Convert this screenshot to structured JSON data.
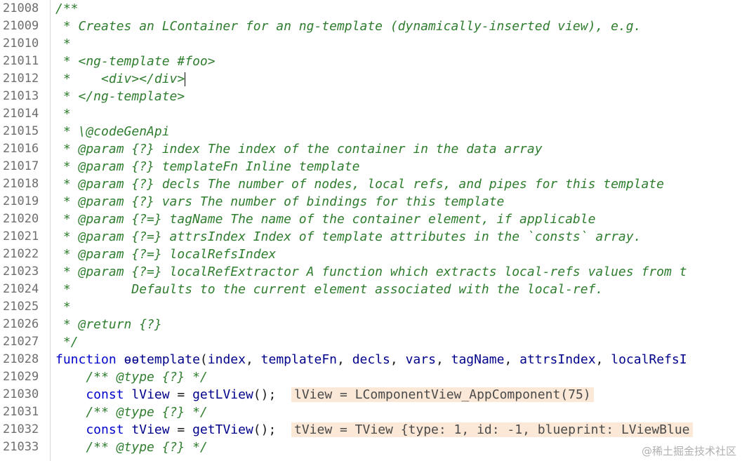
{
  "lines": [
    {
      "n": "21008",
      "parts": [
        {
          "c": "cm",
          "t": "/**"
        }
      ]
    },
    {
      "n": "21009",
      "parts": [
        {
          "c": "cm",
          "t": " * Creates an LContainer for an ng-template (dynamically-inserted view), e.g."
        }
      ]
    },
    {
      "n": "21010",
      "parts": [
        {
          "c": "cm",
          "t": " *"
        }
      ]
    },
    {
      "n": "21011",
      "parts": [
        {
          "c": "cm",
          "t": " * <ng-template #foo>"
        }
      ]
    },
    {
      "n": "21012",
      "parts": [
        {
          "c": "cm",
          "t": " *    <div></div>"
        },
        {
          "c": "caret",
          "t": ""
        }
      ]
    },
    {
      "n": "21013",
      "parts": [
        {
          "c": "cm",
          "t": " * </ng-template>"
        }
      ]
    },
    {
      "n": "21014",
      "parts": [
        {
          "c": "cm",
          "t": " *"
        }
      ]
    },
    {
      "n": "21015",
      "parts": [
        {
          "c": "cm",
          "t": " * \\@codeGenApi"
        }
      ]
    },
    {
      "n": "21016",
      "parts": [
        {
          "c": "cm",
          "t": " * @param {?} index The index of the container in the data array"
        }
      ]
    },
    {
      "n": "21017",
      "parts": [
        {
          "c": "cm",
          "t": " * @param {?} templateFn Inline template"
        }
      ]
    },
    {
      "n": "21018",
      "parts": [
        {
          "c": "cm",
          "t": " * @param {?} decls The number of nodes, local refs, and pipes for this template"
        }
      ]
    },
    {
      "n": "21019",
      "parts": [
        {
          "c": "cm",
          "t": " * @param {?} vars The number of bindings for this template"
        }
      ]
    },
    {
      "n": "21020",
      "parts": [
        {
          "c": "cm",
          "t": " * @param {?=} tagName The name of the container element, if applicable"
        }
      ]
    },
    {
      "n": "21021",
      "parts": [
        {
          "c": "cm",
          "t": " * @param {?=} attrsIndex Index of template attributes in the `consts` array."
        }
      ]
    },
    {
      "n": "21022",
      "parts": [
        {
          "c": "cm",
          "t": " * @param {?=} localRefsIndex"
        }
      ]
    },
    {
      "n": "21023",
      "parts": [
        {
          "c": "cm",
          "t": " * @param {?=} localRefExtractor A function which extracts local-refs values from t"
        }
      ]
    },
    {
      "n": "21024",
      "parts": [
        {
          "c": "cm",
          "t": " *        Defaults to the current element associated with the local-ref."
        }
      ]
    },
    {
      "n": "21025",
      "parts": [
        {
          "c": "cm",
          "t": " *"
        }
      ]
    },
    {
      "n": "21026",
      "parts": [
        {
          "c": "cm",
          "t": " * @return {?}"
        }
      ]
    },
    {
      "n": "21027",
      "parts": [
        {
          "c": "cm",
          "t": " */"
        }
      ]
    },
    {
      "n": "21028",
      "parts": [
        {
          "c": "kw",
          "t": "function"
        },
        {
          "c": "tx",
          "t": " "
        },
        {
          "c": "fn",
          "t": "ɵɵtemplate"
        },
        {
          "c": "tx",
          "t": "("
        },
        {
          "c": "fn",
          "t": "index"
        },
        {
          "c": "tx",
          "t": ", "
        },
        {
          "c": "fn",
          "t": "templateFn"
        },
        {
          "c": "tx",
          "t": ", "
        },
        {
          "c": "fn",
          "t": "decls"
        },
        {
          "c": "tx",
          "t": ", "
        },
        {
          "c": "fn",
          "t": "vars"
        },
        {
          "c": "tx",
          "t": ", "
        },
        {
          "c": "fn",
          "t": "tagName"
        },
        {
          "c": "tx",
          "t": ", "
        },
        {
          "c": "fn",
          "t": "attrsIndex"
        },
        {
          "c": "tx",
          "t": ", "
        },
        {
          "c": "fn",
          "t": "localRefsI"
        }
      ]
    },
    {
      "n": "21029",
      "parts": [
        {
          "c": "cm",
          "t": "    /** @type {?} */"
        }
      ]
    },
    {
      "n": "21030",
      "parts": [
        {
          "c": "kw",
          "t": "    const"
        },
        {
          "c": "tx",
          "t": " "
        },
        {
          "c": "fn",
          "t": "lView"
        },
        {
          "c": "tx",
          "t": " = "
        },
        {
          "c": "fn",
          "t": "getLView"
        },
        {
          "c": "tx",
          "t": "();  "
        },
        {
          "c": "hint",
          "t": "lView = LComponentView_AppComponent(75)"
        }
      ]
    },
    {
      "n": "21031",
      "parts": [
        {
          "c": "cm",
          "t": "    /** @type {?} */"
        }
      ]
    },
    {
      "n": "21032",
      "parts": [
        {
          "c": "kw",
          "t": "    const"
        },
        {
          "c": "tx",
          "t": " "
        },
        {
          "c": "fn",
          "t": "tView"
        },
        {
          "c": "tx",
          "t": " = "
        },
        {
          "c": "fn",
          "t": "getTView"
        },
        {
          "c": "tx",
          "t": "();  "
        },
        {
          "c": "hint",
          "t": "tView = TView {type: 1, id: -1, blueprint: LViewBlue"
        }
      ]
    },
    {
      "n": "21033",
      "parts": [
        {
          "c": "cm",
          "t": "    /** @type {?} */"
        }
      ]
    }
  ],
  "watermark": "@稀土掘金技术社区"
}
